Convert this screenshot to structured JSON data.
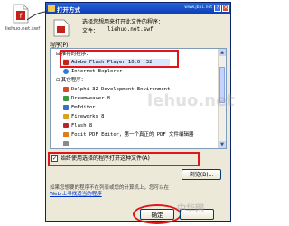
{
  "desktop": {
    "file_name": "liehuo.net.swf"
  },
  "dialog": {
    "title": "打开方式",
    "watermark": "www.jb51.net",
    "instruction": "选择您想用来打开此文件的程序：",
    "file_label": "文件：",
    "file_name": "liehuo.net.swf",
    "programs_label": "程序(P)",
    "recommended_group": "推荐的程序：",
    "recommended_item": "Adobe Flash Player 10.0 r32",
    "recommended_item2": "Internet Explorer",
    "other_group": "其它程序：",
    "other_items": [
      "Delphi-32 Development Environment",
      "Dreamweaver 8",
      "EmEditor",
      "Fireworks 8",
      "Flash 8",
      "Foxit PDF Editor，第一个真正的 PDF 文件编辑器",
      "",
      ""
    ],
    "always_use_label": "始终使用选择的程序打开这种文件(A)",
    "always_use_checked": true,
    "browse_label": "浏览(B)...",
    "hint_text": "如果您想要的程序不在列表或您的计算机上，您可以在",
    "hint_link": "Web 上寻找适当的程序",
    "ok_label": "确定"
  },
  "watermarks": {
    "center": "lehuo.net",
    "corner": "中华网"
  },
  "colors": {
    "highlight": "#e0161a",
    "titlebar": "#0a3fb8",
    "dialog_bg": "#ece9d8"
  },
  "icons": [
    "swf-file-icon",
    "arrow-icon",
    "flash-player-icon",
    "ie-icon",
    "delphi-icon",
    "dreamweaver-icon",
    "emeditor-icon",
    "fireworks-icon",
    "flash-icon",
    "foxit-icon"
  ]
}
